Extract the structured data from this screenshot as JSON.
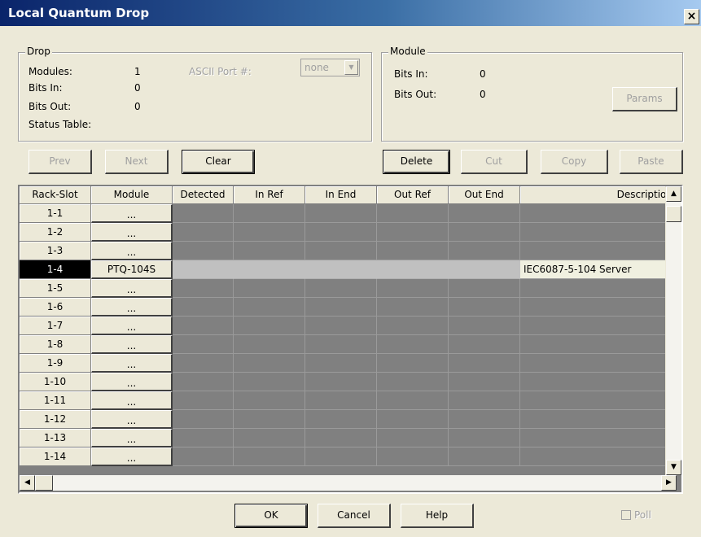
{
  "window": {
    "title": "Local Quantum Drop",
    "close_glyph": "×"
  },
  "drop": {
    "legend": "Drop",
    "modules_label": "Modules:",
    "modules_value": "1",
    "bits_in_label": "Bits In:",
    "bits_in_value": "0",
    "bits_out_label": "Bits Out:",
    "bits_out_value": "0",
    "status_table_label": "Status Table:",
    "ascii_port_label": "ASCII Port #:",
    "ascii_port_value": "none"
  },
  "module": {
    "legend": "Module",
    "bits_in_label": "Bits In:",
    "bits_in_value": "0",
    "bits_out_label": "Bits Out:",
    "bits_out_value": "0",
    "params_label": "Params"
  },
  "toolbar": {
    "prev": "Prev",
    "next": "Next",
    "clear": "Clear",
    "delete": "Delete",
    "cut": "Cut",
    "copy": "Copy",
    "paste": "Paste"
  },
  "grid": {
    "columns": [
      "Rack-Slot",
      "Module",
      "Detected",
      "In Ref",
      "In End",
      "Out Ref",
      "Out End",
      "Description"
    ],
    "rows": [
      {
        "slot": "1-1",
        "module": "..."
      },
      {
        "slot": "1-2",
        "module": "..."
      },
      {
        "slot": "1-3",
        "module": "..."
      },
      {
        "slot": "1-4",
        "module": "PTQ-104S",
        "description": "IEC6087-5-104 Server",
        "selected": true
      },
      {
        "slot": "1-5",
        "module": "..."
      },
      {
        "slot": "1-6",
        "module": "..."
      },
      {
        "slot": "1-7",
        "module": "..."
      },
      {
        "slot": "1-8",
        "module": "..."
      },
      {
        "slot": "1-9",
        "module": "..."
      },
      {
        "slot": "1-10",
        "module": "..."
      },
      {
        "slot": "1-11",
        "module": "..."
      },
      {
        "slot": "1-12",
        "module": "..."
      },
      {
        "slot": "1-13",
        "module": "..."
      },
      {
        "slot": "1-14",
        "module": "..."
      }
    ]
  },
  "footer": {
    "ok": "OK",
    "cancel": "Cancel",
    "help": "Help",
    "poll": "Poll"
  },
  "colors": {
    "title_start": "#0a246a",
    "face": "#ece9d8",
    "empty_cell": "#808080",
    "selected_slot": "#000000"
  }
}
